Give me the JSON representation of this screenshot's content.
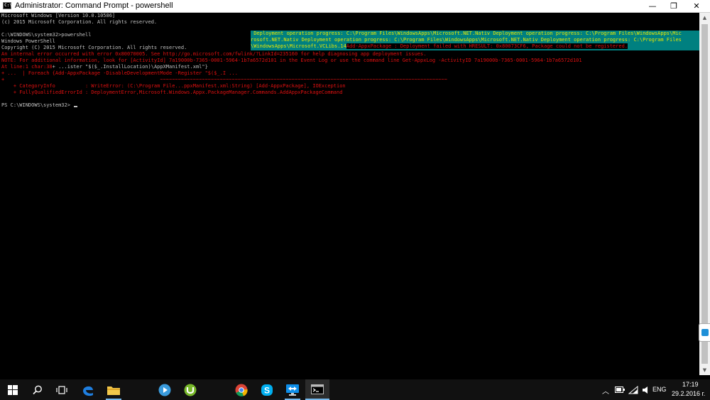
{
  "window": {
    "title": "Administrator: Command Prompt - powershell",
    "minimize_glyph": "—",
    "restore_glyph": "❐",
    "close_glyph": "✕"
  },
  "console_lines": [
    {
      "text": "Microsoft Windows [Version 10.0.10586]",
      "style": "normal"
    },
    {
      "text": "(c) 2015 Microsoft Corporation. All rights reserved.",
      "style": "normal"
    },
    {
      "text": "",
      "style": "normal"
    },
    {
      "text": "C:\\WINDOWS\\system32>powershell",
      "style": "normal"
    },
    {
      "text": "Windows PowerShell",
      "style": "normal"
    },
    {
      "text": "Copyright (C) 2015 Microsoft Corporation. All rights reserved.",
      "style": "normal"
    },
    {
      "text": "An internal error occurred with error 0x80070005. See http://go.microsoft.com/fwlink/?LinkId=235160 for help diagnosing app deployment issues.",
      "style": "red"
    },
    {
      "text": "NOTE: For additional information, look for [ActivityId] 7a19000b-7365-0001-5964-1b7a6572d101 in the Event Log or use the command line Get-AppxLog -ActivityID 7a19000b-7365-0001-5964-1b7a6572d101",
      "style": "red"
    },
    {
      "text": "At line:1 char:38",
      "style": "red",
      "tail": "+ ...ister \"$($_.InstallLocation)\\AppXManifest.xml\"}",
      "tail_style": "normal"
    },
    {
      "text": "+ ...  | Foreach {Add-AppxPackage -DisableDevelopmentMode -Register \"$($_.I ...",
      "style": "red"
    },
    {
      "text": "+                                                    ~~~~~~~~~~~~~~~~~~~~~~~~~~~~~~~~~~~~~~~~~~~~~~~~~~~~~~~~~~~~~~~~~~~~~~~~~~~~~~~~~~~~~~~~~~~~~~~~",
      "style": "red"
    },
    {
      "text": "    + CategoryInfo          : WriteError: (C:\\Program File...ppxManifest.xml:String) [Add-AppxPackage], IOException",
      "style": "red"
    },
    {
      "text": "    + FullyQualifiedErrorId : DeploymentError,Microsoft.Windows.Appx.PackageManager.Commands.AddAppxPackageCommand",
      "style": "red"
    },
    {
      "text": "",
      "style": "normal"
    },
    {
      "text": "PS C:\\WINDOWS\\system32> ",
      "style": "normal",
      "cursor": true
    }
  ],
  "progress_block": {
    "line1": " Deployment operation progress: C:\\Program Files\\WindowsApps\\Microsoft.NET.Nativ Deployment operation progress: C:\\Program Files\\WindowsApps\\Mic",
    "line2": "rosoft.NET.Nativ Deployment operation progress: C:\\Program Files\\WindowsApps\\Microsoft.NET.Nativ Deployment operation progress: C:\\Program Files",
    "line3_lead": "\\WindowsApps\\Microsoft.VCLibs.14",
    "line3_error": "Add-AppxPackage : Deployment failed with HRESULT: 0x80073CF6, Package could not be registered."
  },
  "taskbar": {
    "pinned": [
      {
        "name": "start",
        "icon": "windows-logo-icon"
      },
      {
        "name": "search",
        "icon": "search-icon"
      },
      {
        "name": "task-view",
        "icon": "task-view-icon"
      },
      {
        "name": "edge",
        "icon": "edge-icon"
      },
      {
        "name": "file-explorer",
        "icon": "folder-icon"
      },
      {
        "name": "media-player",
        "icon": "media-player-icon"
      },
      {
        "name": "utorrent",
        "icon": "utorrent-icon"
      },
      {
        "name": "chrome",
        "icon": "chrome-icon"
      },
      {
        "name": "skype",
        "icon": "skype-icon"
      },
      {
        "name": "teamviewer",
        "icon": "teamviewer-icon"
      },
      {
        "name": "command-prompt",
        "icon": "command-prompt-icon"
      }
    ],
    "tray": {
      "language": "ENG",
      "time": "17:19",
      "date": "29.2.2016 г."
    }
  },
  "colors": {
    "console_text": "#c0c0c0",
    "error_text": "#e01010",
    "progress_bg": "#008080",
    "progress_text": "#e8e800",
    "taskbar_bg": "#111111",
    "accent": "#76b9ed"
  }
}
